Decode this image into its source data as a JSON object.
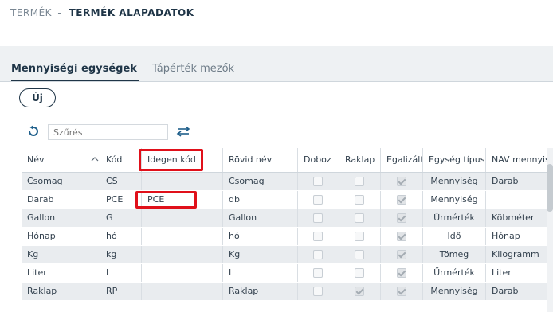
{
  "breadcrumb": {
    "parent": "TERMÉK",
    "separator": "-",
    "current": "TERMÉK ALAPADATOK"
  },
  "tabs": [
    {
      "label": "Mennyiségi egységek",
      "active": true
    },
    {
      "label": "Tápérték mezők",
      "active": false
    }
  ],
  "toolbar": {
    "new_label": "Új",
    "filter_placeholder": "Szűrés"
  },
  "icons": {
    "refresh": "refresh-icon",
    "swap": "swap-arrows-icon",
    "sort": "sort-asc-icon"
  },
  "colors": {
    "accent": "#1f3547",
    "highlight": "#e0101a"
  },
  "table": {
    "columns": [
      "Név",
      "Kód",
      "Idegen kód",
      "Rövid név",
      "Doboz",
      "Raklap",
      "Egalizált",
      "Egység típus",
      "NAV mennyiségi egység"
    ],
    "rows": [
      {
        "nev": "Csomag",
        "kod": "CS",
        "idegen": "",
        "rovid": "Csomag",
        "doboz": false,
        "raklap": false,
        "egalizalt": true,
        "tipus": "Mennyiség",
        "nav": "Darab"
      },
      {
        "nev": "Darab",
        "kod": "PCE",
        "idegen": "PCE",
        "rovid": "db",
        "doboz": false,
        "raklap": false,
        "egalizalt": true,
        "tipus": "Mennyiség",
        "nav": ""
      },
      {
        "nev": "Gallon",
        "kod": "G",
        "idegen": "",
        "rovid": "Gallon",
        "doboz": false,
        "raklap": false,
        "egalizalt": true,
        "tipus": "Űrmérték",
        "nav": "Köbméter"
      },
      {
        "nev": "Hónap",
        "kod": "hó",
        "idegen": "",
        "rovid": "hó",
        "doboz": false,
        "raklap": false,
        "egalizalt": true,
        "tipus": "Idő",
        "nav": "Hónap"
      },
      {
        "nev": "Kg",
        "kod": "kg",
        "idegen": "",
        "rovid": "Kg",
        "doboz": false,
        "raklap": false,
        "egalizalt": true,
        "tipus": "Tömeg",
        "nav": "Kilogramm"
      },
      {
        "nev": "Liter",
        "kod": "L",
        "idegen": "",
        "rovid": "L",
        "doboz": false,
        "raklap": false,
        "egalizalt": true,
        "tipus": "Űrmérték",
        "nav": "Liter"
      },
      {
        "nev": "Raklap",
        "kod": "RP",
        "idegen": "",
        "rovid": "Raklap",
        "doboz": false,
        "raklap": true,
        "egalizalt": true,
        "tipus": "Mennyiség",
        "nav": "Darab"
      }
    ]
  }
}
